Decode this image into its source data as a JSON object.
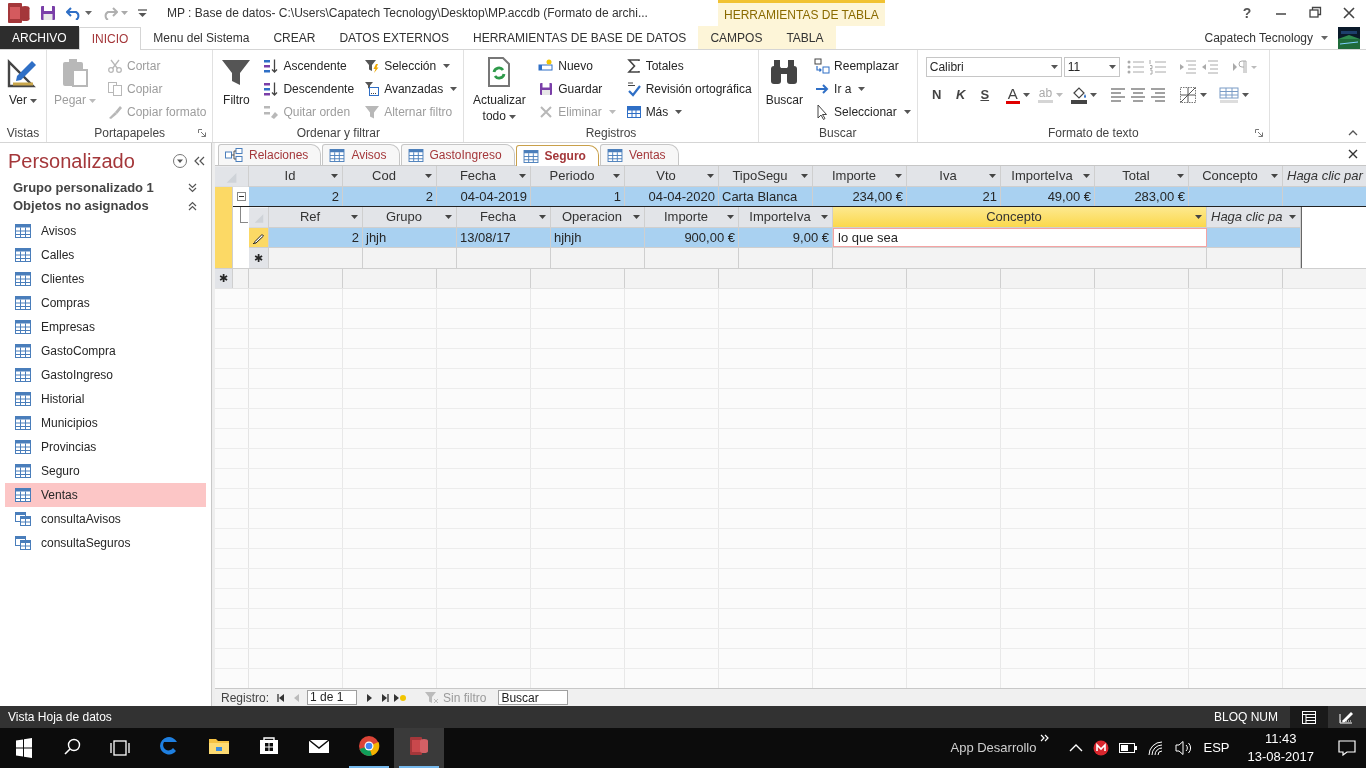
{
  "title_bar": {
    "title": "MP : Base de datos- C:\\Users\\Capatech Tecnology\\Desktop\\MP.accdb (Formato de archi...",
    "context_label": "HERRAMIENTAS DE TABLA",
    "help": "?"
  },
  "ribbon_tabs": [
    {
      "label": "ARCHIVO",
      "kind": "file",
      "selected": false
    },
    {
      "label": "INICIO",
      "kind": "standard",
      "selected": true
    },
    {
      "label": "Menu del Sistema",
      "kind": "standard",
      "selected": false
    },
    {
      "label": "CREAR",
      "kind": "standard",
      "selected": false
    },
    {
      "label": "DATOS EXTERNOS",
      "kind": "standard",
      "selected": false
    },
    {
      "label": "HERRAMIENTAS DE BASE DE DATOS",
      "kind": "standard",
      "selected": false
    },
    {
      "label": "CAMPOS",
      "kind": "context",
      "selected": false
    },
    {
      "label": "TABLA",
      "kind": "context",
      "selected": false
    }
  ],
  "account": {
    "name": "Capatech Tecnology"
  },
  "ribbon_groups": [
    {
      "label": "Vistas",
      "items": [
        {
          "label": "Ver",
          "kind": "large",
          "disabled": false,
          "dropdown": true
        }
      ]
    },
    {
      "label": "Portapapeles",
      "launcher": true,
      "items": [
        {
          "label": "Pegar",
          "kind": "large",
          "disabled": true,
          "dropdown": true
        },
        {
          "label": "Cortar",
          "kind": "small",
          "disabled": true
        },
        {
          "label": "Copiar",
          "kind": "small",
          "disabled": true
        },
        {
          "label": "Copiar formato",
          "kind": "small",
          "disabled": true
        }
      ]
    },
    {
      "label": "Ordenar y filtrar",
      "items": [
        {
          "label": "Filtro",
          "kind": "large",
          "disabled": false
        },
        {
          "label": "Ascendente",
          "kind": "small",
          "disabled": false
        },
        {
          "label": "Descendente",
          "kind": "small",
          "disabled": false
        },
        {
          "label": "Quitar orden",
          "kind": "small",
          "disabled": true
        },
        {
          "label": "Selección",
          "kind": "small",
          "disabled": false,
          "dropdown": true
        },
        {
          "label": "Avanzadas",
          "kind": "small",
          "disabled": false,
          "dropdown": true
        },
        {
          "label": "Alternar filtro",
          "kind": "small",
          "disabled": true
        }
      ]
    },
    {
      "label": "Registros",
      "items": [
        {
          "label": "Actualizar todo",
          "kind": "large",
          "disabled": false,
          "dropdown": true
        },
        {
          "label": "Nuevo",
          "kind": "small",
          "disabled": false
        },
        {
          "label": "Guardar",
          "kind": "small",
          "disabled": false
        },
        {
          "label": "Eliminar",
          "kind": "small",
          "disabled": true,
          "dropdown": true
        },
        {
          "label": "Totales",
          "kind": "small",
          "disabled": false
        },
        {
          "label": "Revisión ortográfica",
          "kind": "small",
          "disabled": false
        },
        {
          "label": "Más",
          "kind": "small",
          "disabled": false,
          "dropdown": true
        }
      ]
    },
    {
      "label": "Buscar",
      "items": [
        {
          "label": "Buscar",
          "kind": "large",
          "disabled": false
        },
        {
          "label": "Reemplazar",
          "kind": "small",
          "disabled": false
        },
        {
          "label": "Ir a",
          "kind": "small",
          "disabled": false,
          "dropdown": true
        },
        {
          "label": "Seleccionar",
          "kind": "small",
          "disabled": false,
          "dropdown": true
        }
      ]
    },
    {
      "label": "Formato de texto",
      "launcher": true,
      "font": "Calibri",
      "font_size": "11",
      "style_buttons": [
        "N",
        "K",
        "S"
      ],
      "font_color_label": "A",
      "highlight_label": "ab"
    }
  ],
  "nav_pane": {
    "title": "Personalizado",
    "groups": [
      {
        "label": "Grupo personalizado 1",
        "expanded": false
      },
      {
        "label": "Objetos no asignados",
        "expanded": true
      }
    ],
    "items": [
      {
        "label": "Avisos",
        "kind": "table",
        "selected": false
      },
      {
        "label": "Calles",
        "kind": "table",
        "selected": false
      },
      {
        "label": "Clientes",
        "kind": "table",
        "selected": false
      },
      {
        "label": "Compras",
        "kind": "table",
        "selected": false
      },
      {
        "label": "Empresas",
        "kind": "table",
        "selected": false
      },
      {
        "label": "GastoCompra",
        "kind": "table",
        "selected": false
      },
      {
        "label": "GastoIngreso",
        "kind": "table",
        "selected": false
      },
      {
        "label": "Historial",
        "kind": "table",
        "selected": false
      },
      {
        "label": "Municipios",
        "kind": "table",
        "selected": false
      },
      {
        "label": "Provincias",
        "kind": "table",
        "selected": false
      },
      {
        "label": "Seguro",
        "kind": "table",
        "selected": false
      },
      {
        "label": "Ventas",
        "kind": "table",
        "selected": true
      },
      {
        "label": "consultaAvisos",
        "kind": "query",
        "selected": false
      },
      {
        "label": "consultaSeguros",
        "kind": "query",
        "selected": false
      }
    ]
  },
  "doc_tabs": [
    {
      "label": "Relaciones",
      "kind": "relationships",
      "selected": false
    },
    {
      "label": "Avisos",
      "kind": "table",
      "selected": false
    },
    {
      "label": "GastoIngreso",
      "kind": "table",
      "selected": false
    },
    {
      "label": "Seguro",
      "kind": "table",
      "selected": true
    },
    {
      "label": "Ventas",
      "kind": "table",
      "selected": false
    }
  ],
  "table": {
    "new_record_marker": "✱",
    "columns": [
      {
        "label": "Id",
        "kind": "number",
        "selected": false
      },
      {
        "label": "Cod",
        "kind": "number",
        "selected": false
      },
      {
        "label": "Fecha",
        "kind": "number",
        "selected": false
      },
      {
        "label": "Periodo",
        "kind": "number",
        "selected": false
      },
      {
        "label": "Vto",
        "kind": "number",
        "selected": false
      },
      {
        "label": "TipoSegu",
        "kind": "text",
        "selected": false
      },
      {
        "label": "Importe",
        "kind": "number",
        "selected": false
      },
      {
        "label": "Iva",
        "kind": "number",
        "selected": false
      },
      {
        "label": "ImporteIva",
        "kind": "number",
        "selected": false
      },
      {
        "label": "Total",
        "kind": "number",
        "selected": false
      },
      {
        "label": "Concepto",
        "kind": "text",
        "selected": false
      },
      {
        "label": "Haga clic par",
        "kind": "add",
        "selected": false
      }
    ],
    "rows": [
      {
        "selected": true,
        "expanded": true,
        "cells": [
          "2",
          "2",
          "04-04-2019",
          "1",
          "04-04-2020",
          "Carta Blanca",
          "234,00 €",
          "21",
          "49,00 €",
          "283,00 €"
        ],
        "subtable": {
          "new_record_marker": "✱",
          "columns": [
            {
              "label": "Ref",
              "kind": "number",
              "selected": false
            },
            {
              "label": "Grupo",
              "kind": "text",
              "selected": false
            },
            {
              "label": "Fecha",
              "kind": "text",
              "selected": false
            },
            {
              "label": "Operacion",
              "kind": "text",
              "selected": false
            },
            {
              "label": "Importe",
              "kind": "number",
              "selected": false
            },
            {
              "label": "ImporteIva",
              "kind": "number",
              "selected": false
            },
            {
              "label": "Concepto",
              "kind": "text",
              "selected": true
            },
            {
              "label": "Haga clic pa",
              "kind": "add",
              "selected": false
            }
          ],
          "rows": [
            {
              "selected": true,
              "editing": true,
              "cells": [
                {
                  "text": "2",
                  "focused": false
                },
                {
                  "text": "jhjh",
                  "focused": false
                },
                {
                  "text": "13/08/17",
                  "focused": false
                },
                {
                  "text": "hjhjh",
                  "focused": false
                },
                {
                  "text": "900,00 €",
                  "focused": false
                },
                {
                  "text": "9,00 €",
                  "focused": false
                },
                {
                  "text": "lo que sea",
                  "focused": true
                }
              ]
            }
          ]
        }
      }
    ]
  },
  "record_nav": {
    "label": "Registro:",
    "position": "1 de 1",
    "filter": "Sin filtro",
    "search_placeholder": "Buscar"
  },
  "status_bar": {
    "text": "Vista Hoja de datos",
    "indicator": "BLOQ NUM",
    "views": [
      {
        "kind": "datasheet",
        "selected": true
      },
      {
        "kind": "design",
        "selected": false
      }
    ]
  },
  "taskbar": {
    "apps": [
      {
        "kind": "edge",
        "running": false,
        "active": false
      },
      {
        "kind": "explorer",
        "running": false,
        "active": false
      },
      {
        "kind": "store",
        "running": false,
        "active": false
      },
      {
        "kind": "mail",
        "running": false,
        "active": false
      },
      {
        "kind": "chrome",
        "running": true,
        "active": false
      },
      {
        "kind": "access",
        "running": true,
        "active": true
      }
    ],
    "toolbar_label": "App Desarrollo",
    "language": "ESP",
    "time": "11:43",
    "date": "13-08-2017"
  }
}
